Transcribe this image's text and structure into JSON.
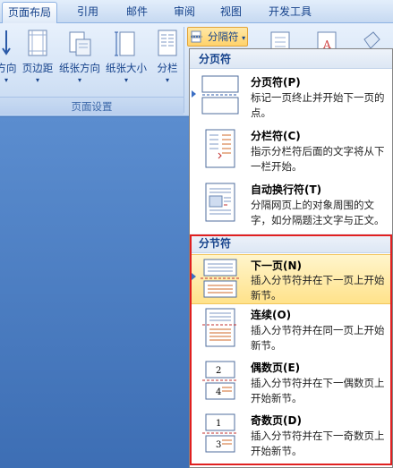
{
  "tabs": [
    {
      "label": "页面布局",
      "active": true
    },
    {
      "label": "引用",
      "active": false
    },
    {
      "label": "邮件",
      "active": false
    },
    {
      "label": "审阅",
      "active": false
    },
    {
      "label": "视图",
      "active": false
    },
    {
      "label": "开发工具",
      "active": false
    }
  ],
  "ribbon": {
    "buttons": [
      {
        "label": "方向"
      },
      {
        "label": "页边距"
      },
      {
        "label": "纸张方向"
      },
      {
        "label": "纸张大小"
      },
      {
        "label": "分栏"
      }
    ],
    "group_label": "页面设置",
    "split_button": "分隔符"
  },
  "menu": {
    "page_break_header": "分页符",
    "page_break_items": [
      {
        "title": "分页符(P)",
        "desc": "标记一页终止并开始下一页的点。",
        "icon": "page-break-icon"
      },
      {
        "title": "分栏符(C)",
        "desc": "指示分栏符后面的文字将从下一栏开始。",
        "icon": "column-break-icon"
      },
      {
        "title": "自动换行符(T)",
        "desc": "分隔网页上的对象周围的文字，如分隔题注文字与正文。",
        "icon": "text-wrapping-break-icon"
      }
    ],
    "section_break_header": "分节符",
    "section_break_items": [
      {
        "title": "下一页(N)",
        "desc": "插入分节符并在下一页上开始新节。",
        "icon": "next-page-icon",
        "highlighted": true
      },
      {
        "title": "连续(O)",
        "desc": "插入分节符并在同一页上开始新节。",
        "icon": "continuous-icon"
      },
      {
        "title": "偶数页(E)",
        "desc": "插入分节符并在下一偶数页上开始新节。",
        "icon": "even-page-icon",
        "num_top": "2",
        "num_bottom": "4"
      },
      {
        "title": "奇数页(D)",
        "desc": "插入分节符并在下一奇数页上开始新节。",
        "icon": "odd-page-icon",
        "num_top": "1",
        "num_bottom": "3"
      }
    ]
  },
  "colors": {
    "highlight": "#ffe28a",
    "annotation_box": "#e02020",
    "ribbon_text": "#15428b"
  }
}
